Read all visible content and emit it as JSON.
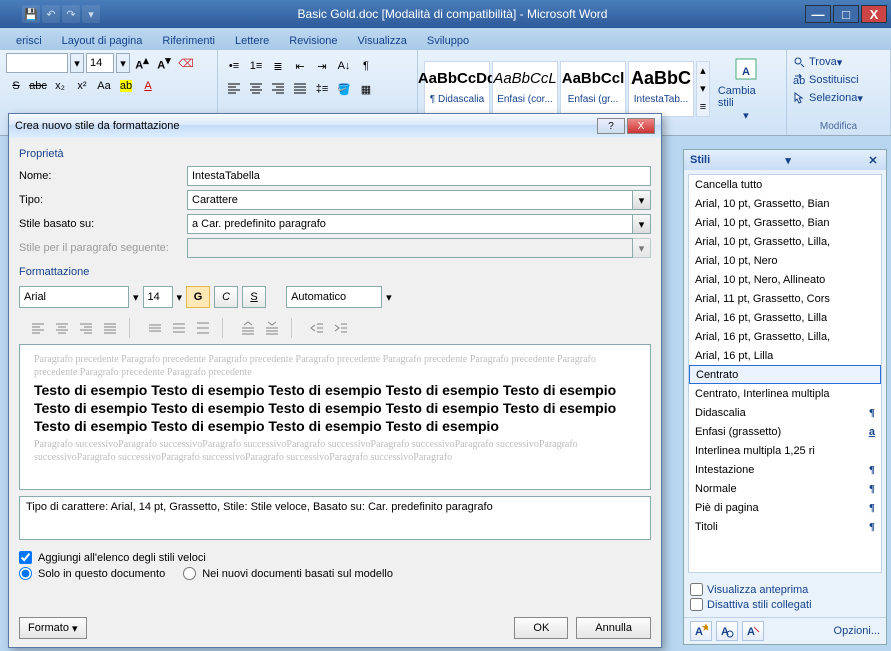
{
  "titlebar": {
    "title": "Basic Gold.doc [Modalità di compatibilità] - Microsoft Word"
  },
  "ribbon_tabs": [
    "erisci",
    "Layout di pagina",
    "Riferimenti",
    "Lettere",
    "Revisione",
    "Visualizza",
    "Sviluppo"
  ],
  "ribbon": {
    "font_size": "14",
    "styles": [
      {
        "preview": "AaBbCcDd",
        "label": "¶ Didascalia",
        "italic": false,
        "bold": true
      },
      {
        "preview": "AaBbCcL",
        "label": "Enfasi (cor...",
        "italic": true,
        "bold": false
      },
      {
        "preview": "AaBbCcl",
        "label": "Enfasi (gr...",
        "italic": false,
        "bold": true
      },
      {
        "preview": "AaBbC",
        "label": "IntestaTab...",
        "italic": false,
        "bold": true
      }
    ],
    "change_styles": "Cambia stili",
    "edit": {
      "find": "Trova",
      "replace": "Sostituisci",
      "select": "Seleziona"
    },
    "group_edit": "Modifica"
  },
  "dialog": {
    "title": "Crea nuovo stile da formattazione",
    "section_props": "Proprietà",
    "name_label": "Nome:",
    "name_value": "IntestaTabella",
    "type_label": "Tipo:",
    "type_value": "Carattere",
    "based_label": "Stile basato su:",
    "based_value": "a Car. predefinito paragrafo",
    "following_label": "Stile per il paragrafo seguente:",
    "section_fmt": "Formattazione",
    "font_name": "Arial",
    "font_size": "14",
    "bold": "G",
    "italic": "C",
    "underline": "S",
    "color": "Automatico",
    "preview_ghost_pre": "Paragrafo precedente Paragrafo precedente Paragrafo precedente Paragrafo precedente Paragrafo precedente Paragrafo precedente Paragrafo precedente Paragrafo precedente Paragrafo precedente",
    "preview_sample": "Testo di esempio Testo di esempio Testo di esempio Testo di esempio Testo di esempio Testo di esempio Testo di esempio Testo di esempio Testo di esempio Testo di esempio Testo di esempio Testo di esempio Testo di esempio Testo di esempio",
    "preview_ghost_post": "Paragrafo successivoParagrafo successivoParagrafo successivoParagrafo successivoParagrafo successivoParagrafo successivoParagrafo successivoParagrafo successivoParagrafo successivoParagrafo successivoParagrafo successivoParagrafo",
    "description": "Tipo di carattere: Arial, 14 pt, Grassetto, Stile: Stile veloce, Basato su: Car. predefinito paragrafo",
    "add_quick": "Aggiungi all'elenco degli stili veloci",
    "only_doc": "Solo in questo documento",
    "new_docs": "Nei nuovi documenti basati sul modello",
    "format_btn": "Formato",
    "ok": "OK",
    "cancel": "Annulla"
  },
  "styles_pane": {
    "title": "Stili",
    "items": [
      {
        "label": "Cancella tutto",
        "mark": ""
      },
      {
        "label": "Arial, 10 pt, Grassetto, Bian",
        "mark": ""
      },
      {
        "label": "Arial, 10 pt, Grassetto, Bian",
        "mark": ""
      },
      {
        "label": "Arial, 10 pt, Grassetto, Lilla,",
        "mark": ""
      },
      {
        "label": "Arial, 10 pt, Nero",
        "mark": ""
      },
      {
        "label": "Arial, 10 pt, Nero, Allineato",
        "mark": ""
      },
      {
        "label": "Arial, 11 pt, Grassetto, Cors",
        "mark": ""
      },
      {
        "label": "Arial, 16 pt, Grassetto, Lilla",
        "mark": ""
      },
      {
        "label": "Arial, 16 pt, Grassetto, Lilla,",
        "mark": ""
      },
      {
        "label": "Arial, 16 pt, Lilla",
        "mark": ""
      },
      {
        "label": "Centrato",
        "mark": "",
        "selected": true
      },
      {
        "label": "Centrato, Interlinea multipla",
        "mark": ""
      },
      {
        "label": "Didascalia",
        "mark": "¶"
      },
      {
        "label": "Enfasi (grassetto)",
        "mark": "a"
      },
      {
        "label": "Interlinea multipla 1,25 ri",
        "mark": ""
      },
      {
        "label": "Intestazione",
        "mark": "¶"
      },
      {
        "label": "Normale",
        "mark": "¶"
      },
      {
        "label": "Piè di pagina",
        "mark": "¶"
      },
      {
        "label": "Titoli",
        "mark": "¶"
      }
    ],
    "show_preview": "Visualizza anteprima",
    "disable_linked": "Disattiva stili collegati",
    "options": "Opzioni..."
  }
}
